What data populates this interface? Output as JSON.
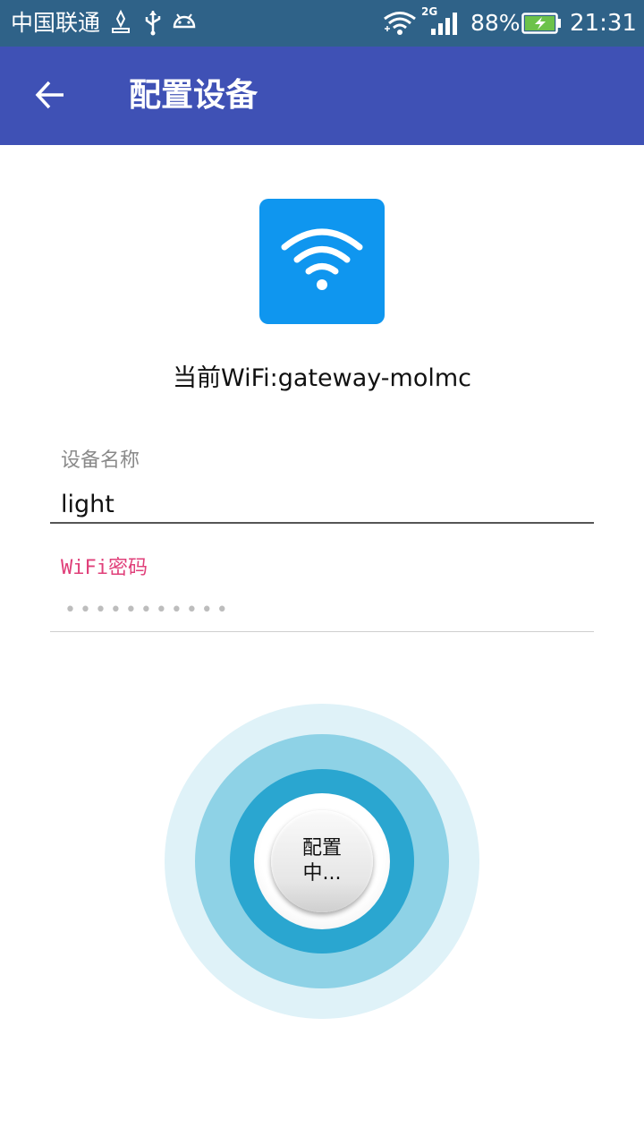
{
  "status_bar": {
    "carrier": "中国联通",
    "network_label": "2G",
    "battery_percent": "88%",
    "time": "21:31",
    "icons": [
      "notification-icon",
      "usb-icon",
      "android-icon",
      "wifi-signal-icon",
      "cell-signal-icon",
      "battery-charging-icon"
    ]
  },
  "app_bar": {
    "back_icon": "arrow-back-icon",
    "title": "配置设备"
  },
  "wifi_icon": "wifi-icon",
  "current_wifi": "当前WiFi:gateway-molmc",
  "form": {
    "device_name_label": "设备名称",
    "device_name_value": "light",
    "password_label": "WiFi密码",
    "password_masked": "•••••••••••"
  },
  "config_button": {
    "label": "配置中..."
  },
  "colors": {
    "status_bar": "#2f6288",
    "app_bar": "#3f51b5",
    "wifi_tile": "#0f96ef",
    "password_label": "#e0407a",
    "ring_outer": "#dff2f8",
    "ring_middle": "#8ed2e6",
    "ring_inner": "#2aa6d0"
  }
}
